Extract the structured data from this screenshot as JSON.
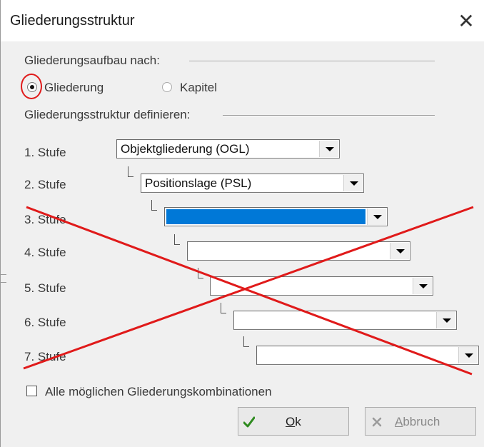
{
  "window": {
    "title": "Gliederungsstruktur",
    "close_icon": "close-icon"
  },
  "section_aufbau": {
    "label": "Gliederungsaufbau nach:",
    "options": [
      {
        "label": "Gliederung",
        "checked": true
      },
      {
        "label": "Kapitel",
        "checked": false
      }
    ]
  },
  "section_struktur": {
    "label": "Gliederungsstruktur definieren:",
    "levels": [
      {
        "label": "1. Stufe",
        "value": "Objektgliederung (OGL)"
      },
      {
        "label": "2. Stufe",
        "value": "Positionslage (PSL)"
      },
      {
        "label": "3. Stufe",
        "value": "",
        "highlighted": true
      },
      {
        "label": "4. Stufe",
        "value": ""
      },
      {
        "label": "5. Stufe",
        "value": ""
      },
      {
        "label": "6. Stufe",
        "value": ""
      },
      {
        "label": "7. Stufe",
        "value": ""
      }
    ]
  },
  "checkbox_all": {
    "label": "Alle möglichen Gliederungskombinationen",
    "checked": false
  },
  "buttons": {
    "ok": {
      "label": "Ok",
      "icon": "checkmark-icon",
      "enabled": true
    },
    "cancel": {
      "label": "Abbruch",
      "icon": "cross-icon",
      "enabled": false
    }
  },
  "colors": {
    "selection": "#0078d7",
    "annotation": "#e01a1a",
    "ok_check": "#2e8b1f"
  }
}
